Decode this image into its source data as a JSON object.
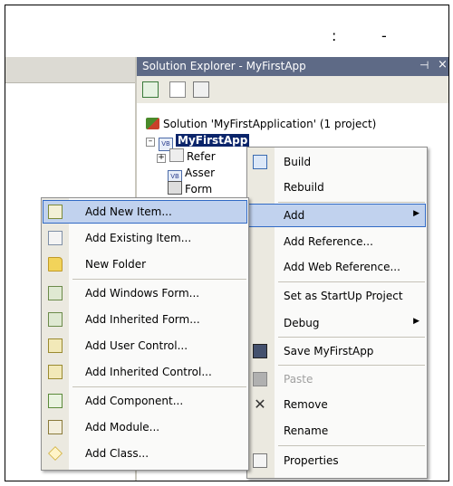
{
  "top_marks": [
    ":",
    "-"
  ],
  "solution_explorer": {
    "title": "Solution Explorer - MyFirstApp",
    "pin_glyph": "⊣",
    "close_glyph": "×"
  },
  "tree": {
    "solution_label": "Solution 'MyFirstApplication' (1 project)",
    "project_label": "MyFirstApp",
    "children": [
      "Refer",
      "Asser",
      "Form"
    ]
  },
  "context_menu": {
    "items": [
      {
        "label": "Build",
        "icon": "build-icon"
      },
      {
        "label": "Rebuild"
      },
      {
        "label": "Add",
        "submenu": true
      },
      {
        "label": "Add Reference..."
      },
      {
        "label": "Add Web Reference..."
      },
      {
        "label": "Set as StartUp Project"
      },
      {
        "label": "Debug",
        "submenu": true
      },
      {
        "label": "Save MyFirstApp",
        "icon": "save-icon"
      },
      {
        "label": "Paste",
        "icon": "paste-icon",
        "disabled": true
      },
      {
        "label": "Remove",
        "icon": "remove-icon"
      },
      {
        "label": "Rename"
      },
      {
        "label": "Properties",
        "icon": "properties-icon"
      }
    ]
  },
  "add_submenu": {
    "items": [
      {
        "label": "Add New Item...",
        "icon": "add-new-item-icon"
      },
      {
        "label": "Add Existing Item...",
        "icon": "add-existing-item-icon"
      },
      {
        "label": "New Folder",
        "icon": "new-folder-icon"
      },
      {
        "label": "Add Windows Form...",
        "icon": "windows-form-icon"
      },
      {
        "label": "Add Inherited Form...",
        "icon": "inherited-form-icon"
      },
      {
        "label": "Add User Control...",
        "icon": "user-control-icon"
      },
      {
        "label": "Add Inherited Control...",
        "icon": "inherited-control-icon"
      },
      {
        "label": "Add Component...",
        "icon": "component-icon"
      },
      {
        "label": "Add Module...",
        "icon": "module-icon"
      },
      {
        "label": "Add Class...",
        "icon": "class-icon"
      }
    ]
  },
  "colors": {
    "title_bar": "#5e6a86",
    "selection_fill": "#c1d2ee",
    "selection_border": "#316ac5",
    "tree_selection": "#0a246a",
    "menu_gutter": "#ebe9e0"
  }
}
